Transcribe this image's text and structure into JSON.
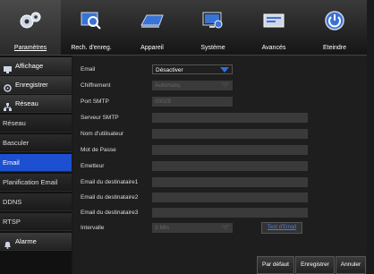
{
  "tabs": [
    {
      "label": "Paramètres",
      "icon": "gears-icon"
    },
    {
      "label": "Rech. d'enreg.",
      "icon": "search-playback-icon"
    },
    {
      "label": "Appareil",
      "icon": "hard-disk-icon"
    },
    {
      "label": "Système",
      "icon": "system-monitor-icon"
    },
    {
      "label": "Avancés",
      "icon": "advanced-config-icon"
    },
    {
      "label": "Eteindre",
      "icon": "power-icon"
    }
  ],
  "sidebar": {
    "affichage": "Affichage",
    "enregistrer": "Enregistrer",
    "reseau_cat": "Réseau",
    "items": [
      "Réseau",
      "Basculer",
      "Email",
      "Planification Email",
      "DDNS",
      "RTSP"
    ],
    "alarme": "Alarme"
  },
  "form": {
    "email": {
      "label": "Email",
      "value": "Désactiver"
    },
    "chiffrement": {
      "label": "Chiffrement",
      "value": "Automatq."
    },
    "port": {
      "label": "Port SMTP",
      "value": "00025"
    },
    "serveur": {
      "label": "Serveur SMTP"
    },
    "utilisateur": {
      "label": "Nom d'utilisateur"
    },
    "motdepasse": {
      "label": "Mot de Passe"
    },
    "emetteur": {
      "label": "Emetteur"
    },
    "dest1": {
      "label": "Email du destinataire1"
    },
    "dest2": {
      "label": "Email du destinataire2"
    },
    "dest3": {
      "label": "Email du destinataire3"
    },
    "intervalle": {
      "label": "Intervalle",
      "value": "3 Min"
    },
    "test_label": "Test d'Email"
  },
  "buttons": {
    "defaut": "Par défaut",
    "enregistrer": "Enregistrer",
    "annuler": "Annuler"
  },
  "colors": {
    "accent": "#1d4fd1",
    "arrow": "#2c6fe0"
  }
}
